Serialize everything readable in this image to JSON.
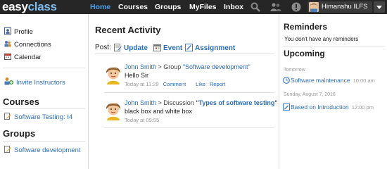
{
  "topbar": {
    "logo_part1": "easy",
    "logo_part2": "class",
    "nav": [
      "Home",
      "Courses",
      "Groups",
      "MyFiles",
      "Inbox"
    ],
    "user_name": "Himanshu ILFS",
    "icons": [
      "search-icon",
      "people-icon",
      "alert-icon",
      "chevron-down-icon"
    ]
  },
  "sidebar": {
    "links": [
      "Profile",
      "Connections",
      "Calendar"
    ],
    "invite": "Invite Instructors",
    "courses_heading": "Courses",
    "course_item": "Software Testing: I4",
    "groups_heading": "Groups",
    "group_item": "Software development"
  },
  "main": {
    "title": "Recent Activity",
    "post_label": "Post:",
    "post_options": [
      "Update",
      "Event",
      "Assignment"
    ],
    "activities": [
      {
        "author": "John Smith",
        "sep": " > ",
        "kind": "Group ",
        "target": "\"Software development\"",
        "message": "Hello Sir",
        "time": "Today at 11:29",
        "actions": [
          "Comment",
          "Like",
          "Report"
        ]
      },
      {
        "author": "John Smith",
        "sep": " > ",
        "kind": "Discussion ",
        "target": "\"Types of software testing\"",
        "message": "black box and white box",
        "time": "Today at 09:55",
        "actions": []
      }
    ]
  },
  "right": {
    "reminders_heading": "Reminders",
    "reminders_empty": "You don't have any reminders",
    "upcoming_heading": "Upcoming",
    "groups": [
      {
        "date": "Tomorrow",
        "title": "Software maintenance",
        "time": "10:00 am"
      },
      {
        "date": "Sunday, August 7, 2016",
        "title": "Based on Introduction",
        "time": "12:00 pm"
      }
    ]
  },
  "colors": {
    "topbar": "#262626",
    "accent": "#4aa3e6",
    "link": "#2a6db8"
  }
}
